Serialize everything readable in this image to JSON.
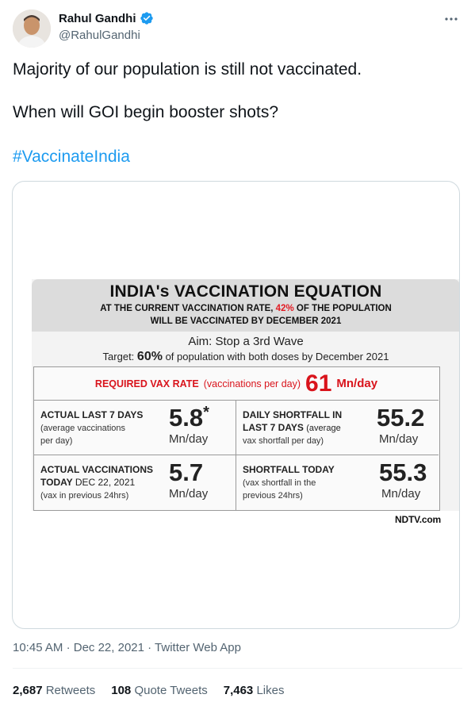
{
  "author": {
    "display_name": "Rahul Gandhi",
    "handle": "@RahulGandhi",
    "verified_icon": "verified-badge-icon"
  },
  "tweet": {
    "line1": "Majority of our population is still not vaccinated.",
    "line2": "When will GOI begin booster shots?",
    "hashtag": "#VaccinateIndia"
  },
  "graphic": {
    "title": "INDIA's VACCINATION EQUATION",
    "sub1_a": "AT THE CURRENT VACCINATION RATE,",
    "sub1_pct": "42%",
    "sub1_b": "OF THE POPULATION",
    "sub2": "WILL BE VACCINATED BY DECEMBER 2021",
    "aim": "Aim: Stop a 3rd Wave",
    "target_a": "Target:",
    "target_pct": "60%",
    "target_b": "of population with both doses by December 2021",
    "required_label": "REQUIRED VAX RATE",
    "required_sub": "(vaccinations per day)",
    "required_value": "61",
    "required_unit": "Mn/day",
    "cells": [
      {
        "title": "ACTUAL LAST 7 DAYS",
        "desc1": "(average vaccinations",
        "desc2": "per day)",
        "value": "5.8",
        "asterisk": "*",
        "unit": "Mn/day"
      },
      {
        "title1": "DAILY SHORTFALL IN",
        "title2": "LAST 7 DAYS",
        "title2_note": "(average",
        "desc": "vax shortfall per day)",
        "value": "55.2",
        "unit": "Mn/day"
      },
      {
        "title1": "ACTUAL VACCINATIONS",
        "title2": "TODAY",
        "title2_note": "DEC 22, 2021",
        "desc": "(vax in previous 24hrs)",
        "value": "5.7",
        "unit": "Mn/day"
      },
      {
        "title": "SHORTFALL TODAY",
        "desc1": "(vax shortfall in the",
        "desc2": "previous 24hrs)",
        "value": "55.3",
        "unit": "Mn/day"
      }
    ],
    "source": "NDTV.com"
  },
  "meta": {
    "time": "10:45 AM",
    "dot1": "·",
    "date": "Dec 22, 2021",
    "dot2": "·",
    "source_app": "Twitter Web App"
  },
  "stats": {
    "retweets": "2,687",
    "retweets_label": "Retweets",
    "quotes": "108",
    "quotes_label": "Quote Tweets",
    "likes": "7,463",
    "likes_label": "Likes"
  },
  "colors": {
    "accent": "#1d9bf0",
    "muted": "#536471",
    "alert_red": "#d9141c"
  }
}
